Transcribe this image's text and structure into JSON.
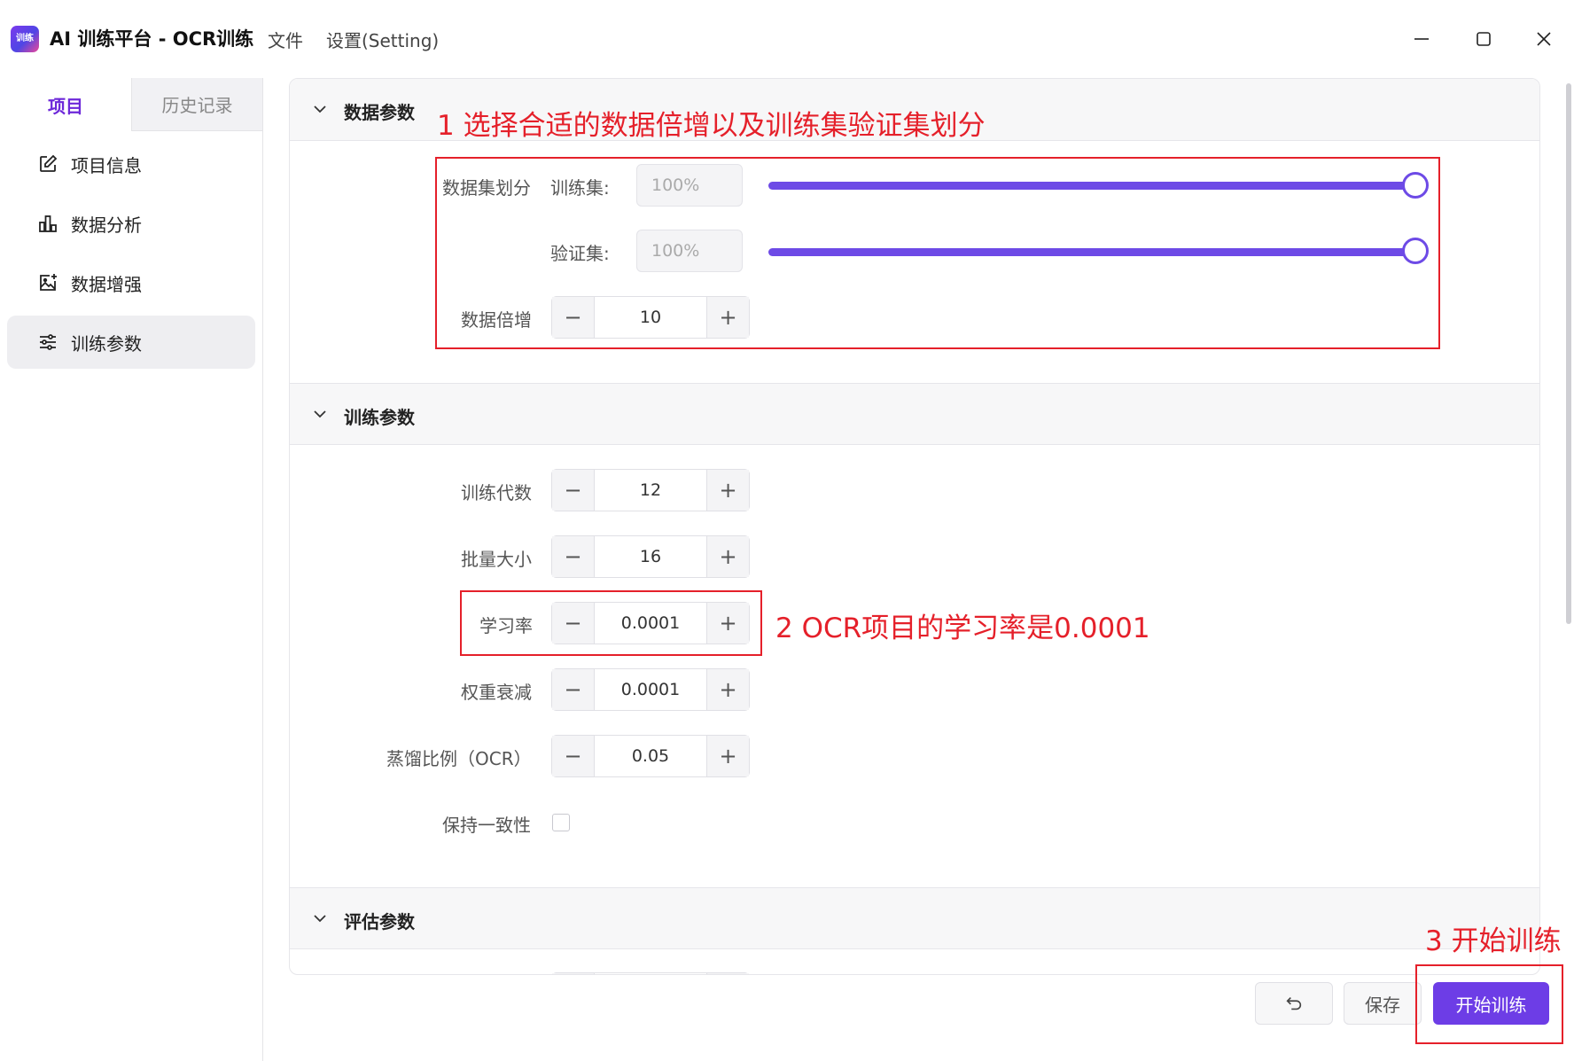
{
  "app": {
    "logo_text": "训练",
    "title": "AI 训练平台 - OCR训练",
    "menu": [
      "文件",
      "设置(Setting)"
    ]
  },
  "sidebar": {
    "tabs": [
      {
        "label": "项目",
        "active": true
      },
      {
        "label": "历史记录",
        "active": false
      }
    ],
    "items": [
      {
        "label": "项目信息",
        "icon": "edit-icon",
        "selected": false
      },
      {
        "label": "数据分析",
        "icon": "bar-chart-icon",
        "selected": false
      },
      {
        "label": "数据增强",
        "icon": "image-plus-icon",
        "selected": false
      },
      {
        "label": "训练参数",
        "icon": "sliders-icon",
        "selected": true
      }
    ]
  },
  "sections": {
    "data_params": {
      "title": "数据参数",
      "split_label": "数据集划分",
      "train_label": "训练集:",
      "train_value": "100%",
      "train_fraction": 1.0,
      "val_label": "验证集:",
      "val_value": "100%",
      "val_fraction": 1.0,
      "multiplier_label": "数据倍增",
      "multiplier_value": "10"
    },
    "train_params": {
      "title": "训练参数",
      "epochs_label": "训练代数",
      "epochs_value": "12",
      "batch_label": "批量大小",
      "batch_value": "16",
      "lr_label": "学习率",
      "lr_value": "0.0001",
      "wd_label": "权重衰减",
      "wd_value": "0.0001",
      "distill_label": "蒸馏比例（OCR）",
      "distill_value": "0.05",
      "consistency_label": "保持一致性",
      "consistency_checked": false
    },
    "eval_params": {
      "title": "评估参数"
    }
  },
  "footer": {
    "save_label": "保存",
    "start_label": "开始训练"
  },
  "annotations": {
    "note1": "1 选择合适的数据倍增以及训练集验证集划分",
    "note2": "2 OCR项目的学习率是0.0001",
    "note3": "3 开始训练"
  },
  "colors": {
    "accent": "#6d3de6",
    "annotation": "#e5202a"
  }
}
